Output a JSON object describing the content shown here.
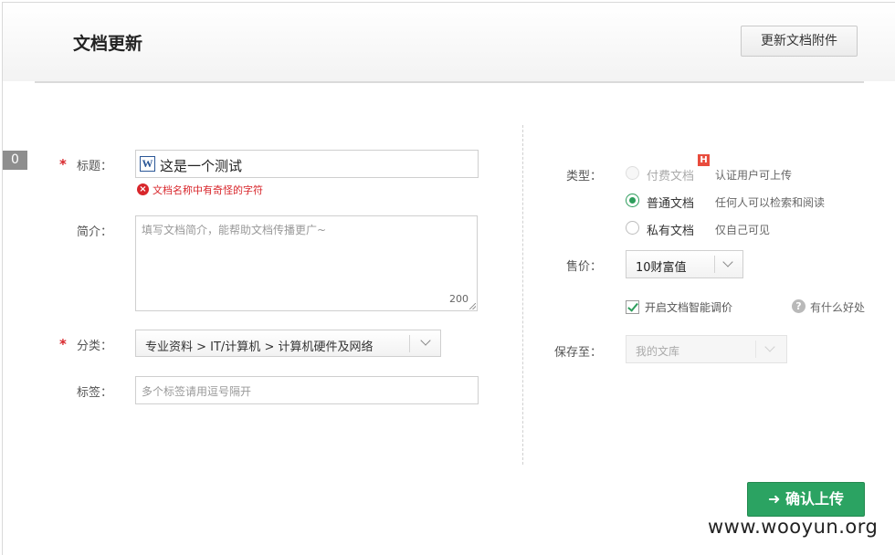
{
  "header": {
    "title": "文档更新",
    "attach_button": "更新文档附件"
  },
  "side_tab": "0",
  "form": {
    "title_label": "标题：",
    "title_value": "这是一个测试",
    "title_file_icon": "W",
    "title_error": "文档名称中有奇怪的字符",
    "summary_label": "简介：",
    "summary_placeholder": "填写文档简介，能帮助文档传播更广~",
    "summary_counter": "200",
    "category_label": "分类：",
    "category_value": "专业资料 > IT/计算机 > 计算机硬件及网络",
    "tags_label": "标签：",
    "tags_placeholder": "多个标签请用逗号隔开",
    "required_mark": "*"
  },
  "settings": {
    "type_label": "类型：",
    "type_options": [
      {
        "label": "付费文档",
        "desc": "认证用户可上传",
        "checked": false,
        "disabled": true
      },
      {
        "label": "普通文档",
        "desc": "任何人可以检索和阅读",
        "checked": true,
        "disabled": false
      },
      {
        "label": "私有文档",
        "desc": "仅自己可见",
        "checked": false,
        "disabled": false
      }
    ],
    "hot_badge": "H",
    "price_label": "售价：",
    "price_value": "10财富值",
    "smart_price_label": "开启文档智能调价",
    "smart_price_checked": true,
    "help_text": "有什么好处",
    "help_icon": "?",
    "save_label": "保存至：",
    "save_value": "我的文库"
  },
  "confirm_button": "确认上传",
  "confirm_arrow": "➜",
  "watermark": "www.wooyun.org",
  "colors": {
    "accent_green": "#2ba362",
    "error_red": "#d8262b"
  }
}
